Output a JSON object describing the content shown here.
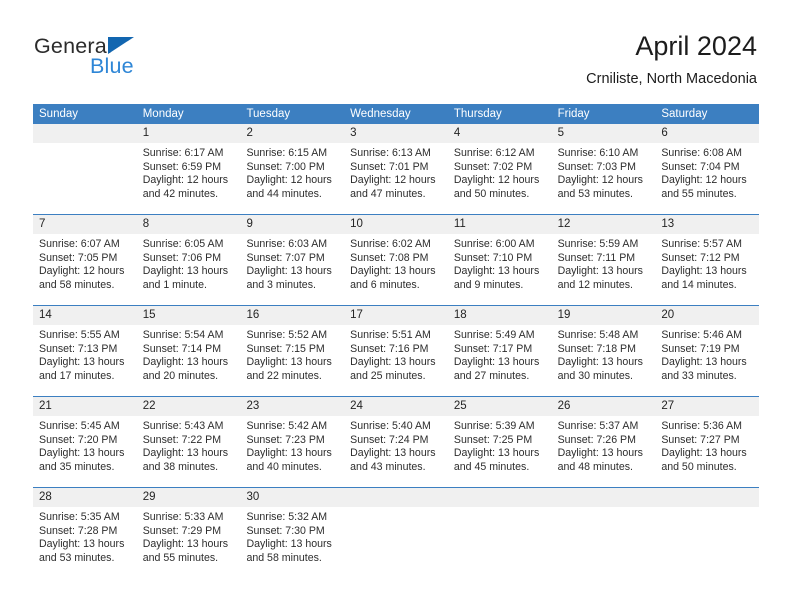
{
  "brand": {
    "word1": "General",
    "word2": "Blue",
    "triangle_color": "#1266b0",
    "blue_color": "#2e86d6"
  },
  "header": {
    "title": "April 2024",
    "subtitle": "Crniliste, North Macedonia"
  },
  "theme": {
    "header_blue": "#3c7fc1",
    "number_band": "#f0f0f0",
    "text": "#2d2d2d"
  },
  "weekdays": [
    "Sunday",
    "Monday",
    "Tuesday",
    "Wednesday",
    "Thursday",
    "Friday",
    "Saturday"
  ],
  "weeks": [
    {
      "days": [
        {
          "num": "",
          "lines": [
            "",
            "",
            "",
            ""
          ]
        },
        {
          "num": "1",
          "lines": [
            "Sunrise: 6:17 AM",
            "Sunset: 6:59 PM",
            "Daylight: 12 hours",
            "and 42 minutes."
          ]
        },
        {
          "num": "2",
          "lines": [
            "Sunrise: 6:15 AM",
            "Sunset: 7:00 PM",
            "Daylight: 12 hours",
            "and 44 minutes."
          ]
        },
        {
          "num": "3",
          "lines": [
            "Sunrise: 6:13 AM",
            "Sunset: 7:01 PM",
            "Daylight: 12 hours",
            "and 47 minutes."
          ]
        },
        {
          "num": "4",
          "lines": [
            "Sunrise: 6:12 AM",
            "Sunset: 7:02 PM",
            "Daylight: 12 hours",
            "and 50 minutes."
          ]
        },
        {
          "num": "5",
          "lines": [
            "Sunrise: 6:10 AM",
            "Sunset: 7:03 PM",
            "Daylight: 12 hours",
            "and 53 minutes."
          ]
        },
        {
          "num": "6",
          "lines": [
            "Sunrise: 6:08 AM",
            "Sunset: 7:04 PM",
            "Daylight: 12 hours",
            "and 55 minutes."
          ]
        }
      ]
    },
    {
      "days": [
        {
          "num": "7",
          "lines": [
            "Sunrise: 6:07 AM",
            "Sunset: 7:05 PM",
            "Daylight: 12 hours",
            "and 58 minutes."
          ]
        },
        {
          "num": "8",
          "lines": [
            "Sunrise: 6:05 AM",
            "Sunset: 7:06 PM",
            "Daylight: 13 hours",
            "and 1 minute."
          ]
        },
        {
          "num": "9",
          "lines": [
            "Sunrise: 6:03 AM",
            "Sunset: 7:07 PM",
            "Daylight: 13 hours",
            "and 3 minutes."
          ]
        },
        {
          "num": "10",
          "lines": [
            "Sunrise: 6:02 AM",
            "Sunset: 7:08 PM",
            "Daylight: 13 hours",
            "and 6 minutes."
          ]
        },
        {
          "num": "11",
          "lines": [
            "Sunrise: 6:00 AM",
            "Sunset: 7:10 PM",
            "Daylight: 13 hours",
            "and 9 minutes."
          ]
        },
        {
          "num": "12",
          "lines": [
            "Sunrise: 5:59 AM",
            "Sunset: 7:11 PM",
            "Daylight: 13 hours",
            "and 12 minutes."
          ]
        },
        {
          "num": "13",
          "lines": [
            "Sunrise: 5:57 AM",
            "Sunset: 7:12 PM",
            "Daylight: 13 hours",
            "and 14 minutes."
          ]
        }
      ]
    },
    {
      "days": [
        {
          "num": "14",
          "lines": [
            "Sunrise: 5:55 AM",
            "Sunset: 7:13 PM",
            "Daylight: 13 hours",
            "and 17 minutes."
          ]
        },
        {
          "num": "15",
          "lines": [
            "Sunrise: 5:54 AM",
            "Sunset: 7:14 PM",
            "Daylight: 13 hours",
            "and 20 minutes."
          ]
        },
        {
          "num": "16",
          "lines": [
            "Sunrise: 5:52 AM",
            "Sunset: 7:15 PM",
            "Daylight: 13 hours",
            "and 22 minutes."
          ]
        },
        {
          "num": "17",
          "lines": [
            "Sunrise: 5:51 AM",
            "Sunset: 7:16 PM",
            "Daylight: 13 hours",
            "and 25 minutes."
          ]
        },
        {
          "num": "18",
          "lines": [
            "Sunrise: 5:49 AM",
            "Sunset: 7:17 PM",
            "Daylight: 13 hours",
            "and 27 minutes."
          ]
        },
        {
          "num": "19",
          "lines": [
            "Sunrise: 5:48 AM",
            "Sunset: 7:18 PM",
            "Daylight: 13 hours",
            "and 30 minutes."
          ]
        },
        {
          "num": "20",
          "lines": [
            "Sunrise: 5:46 AM",
            "Sunset: 7:19 PM",
            "Daylight: 13 hours",
            "and 33 minutes."
          ]
        }
      ]
    },
    {
      "days": [
        {
          "num": "21",
          "lines": [
            "Sunrise: 5:45 AM",
            "Sunset: 7:20 PM",
            "Daylight: 13 hours",
            "and 35 minutes."
          ]
        },
        {
          "num": "22",
          "lines": [
            "Sunrise: 5:43 AM",
            "Sunset: 7:22 PM",
            "Daylight: 13 hours",
            "and 38 minutes."
          ]
        },
        {
          "num": "23",
          "lines": [
            "Sunrise: 5:42 AM",
            "Sunset: 7:23 PM",
            "Daylight: 13 hours",
            "and 40 minutes."
          ]
        },
        {
          "num": "24",
          "lines": [
            "Sunrise: 5:40 AM",
            "Sunset: 7:24 PM",
            "Daylight: 13 hours",
            "and 43 minutes."
          ]
        },
        {
          "num": "25",
          "lines": [
            "Sunrise: 5:39 AM",
            "Sunset: 7:25 PM",
            "Daylight: 13 hours",
            "and 45 minutes."
          ]
        },
        {
          "num": "26",
          "lines": [
            "Sunrise: 5:37 AM",
            "Sunset: 7:26 PM",
            "Daylight: 13 hours",
            "and 48 minutes."
          ]
        },
        {
          "num": "27",
          "lines": [
            "Sunrise: 5:36 AM",
            "Sunset: 7:27 PM",
            "Daylight: 13 hours",
            "and 50 minutes."
          ]
        }
      ]
    },
    {
      "days": [
        {
          "num": "28",
          "lines": [
            "Sunrise: 5:35 AM",
            "Sunset: 7:28 PM",
            "Daylight: 13 hours",
            "and 53 minutes."
          ]
        },
        {
          "num": "29",
          "lines": [
            "Sunrise: 5:33 AM",
            "Sunset: 7:29 PM",
            "Daylight: 13 hours",
            "and 55 minutes."
          ]
        },
        {
          "num": "30",
          "lines": [
            "Sunrise: 5:32 AM",
            "Sunset: 7:30 PM",
            "Daylight: 13 hours",
            "and 58 minutes."
          ]
        },
        {
          "num": "",
          "lines": [
            "",
            "",
            "",
            ""
          ]
        },
        {
          "num": "",
          "lines": [
            "",
            "",
            "",
            ""
          ]
        },
        {
          "num": "",
          "lines": [
            "",
            "",
            "",
            ""
          ]
        },
        {
          "num": "",
          "lines": [
            "",
            "",
            "",
            ""
          ]
        }
      ]
    }
  ]
}
